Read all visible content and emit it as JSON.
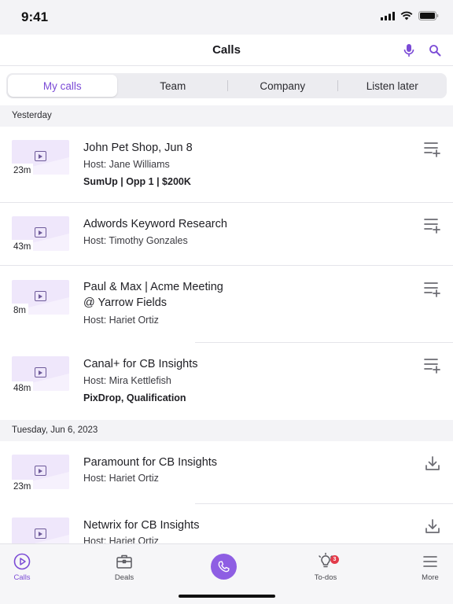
{
  "status": {
    "time": "9:41"
  },
  "header": {
    "title": "Calls",
    "mic_icon": "mic-icon",
    "search_icon": "search-icon"
  },
  "tabs": [
    {
      "label": "My calls",
      "active": true
    },
    {
      "label": "Team",
      "active": false
    },
    {
      "label": "Company",
      "active": false
    },
    {
      "label": "Listen later",
      "active": false
    }
  ],
  "sections": [
    {
      "label": "Yesterday",
      "calls": [
        {
          "title": "John Pet Shop, Jun 8",
          "host": "Host: Jane Williams",
          "tags": "SumUp | Opp 1 | $200K",
          "duration": "23m",
          "action": "add-to-queue-icon"
        },
        {
          "title": "Adwords Keyword Research",
          "host": "Host: Timothy Gonzales",
          "duration": "43m",
          "action": "add-to-queue-icon"
        },
        {
          "title": "Paul & Max | Acme Meeting @ Yarrow Fields",
          "host": "Host: Hariet Ortiz",
          "duration": "8m",
          "action": "add-to-queue-icon"
        },
        {
          "title": "Canal+ for CB Insights",
          "host": "Host: Mira Kettlefish",
          "tags": "PixDrop, Qualification",
          "duration": "48m",
          "action": "add-to-queue-icon"
        }
      ]
    },
    {
      "label": "Tuesday, Jun 6, 2023",
      "calls": [
        {
          "title": "Paramount for CB Insights",
          "host": "Host: Hariet Ortiz",
          "duration": "23m",
          "action": "download-icon"
        },
        {
          "title": "Netwrix for CB Insights",
          "host": "Host: Hariet Ortiz",
          "duration": "",
          "action": "download-icon"
        }
      ]
    }
  ],
  "tab_bar": {
    "items": [
      {
        "label": "Calls",
        "icon": "play-circle-icon",
        "active": true
      },
      {
        "label": "Deals",
        "icon": "briefcase-icon",
        "active": false
      },
      {
        "label": "",
        "icon": "phone-icon",
        "active": false
      },
      {
        "label": "To-dos",
        "icon": "lightbulb-icon",
        "badge": "3",
        "active": false
      },
      {
        "label": "More",
        "icon": "menu-icon",
        "active": false
      }
    ]
  },
  "colors": {
    "accent": "#7b4bd6",
    "fab": "#8e5ee3",
    "thumb": "#efe7fb",
    "badge": "#e23b4a"
  }
}
